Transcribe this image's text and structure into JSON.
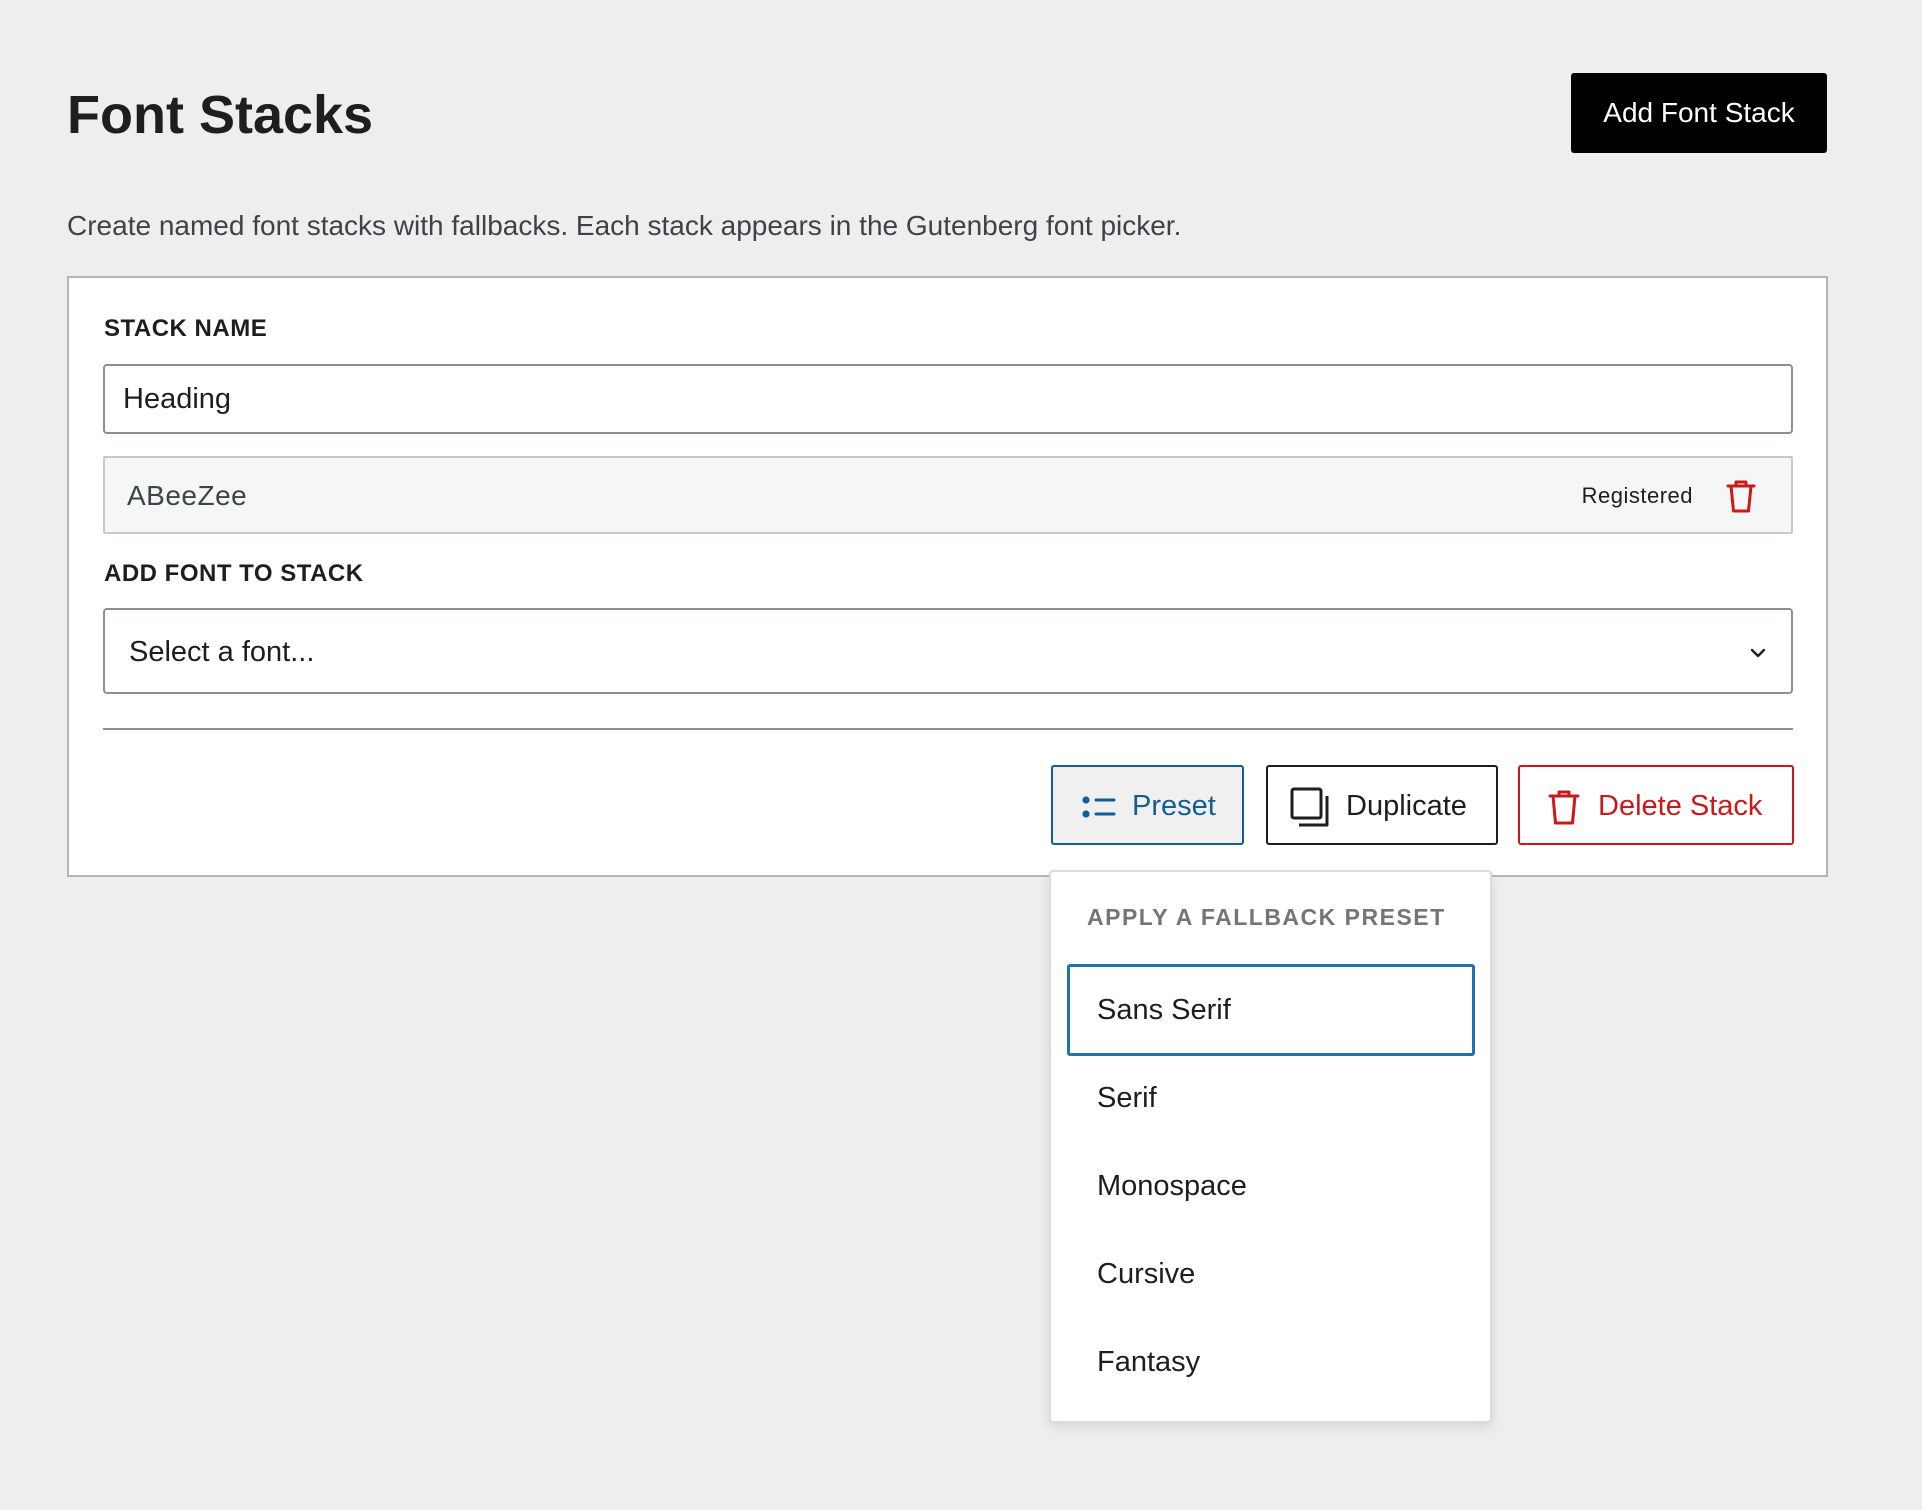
{
  "header": {
    "title": "Font Stacks",
    "add_button_label": "Add Font Stack"
  },
  "description": "Create named font stacks with fallbacks. Each stack appears in the Gutenberg font picker.",
  "stack": {
    "name_label": "STACK NAME",
    "name_value": "Heading",
    "fonts": [
      {
        "name": "ABeeZee",
        "badge": "Registered"
      }
    ],
    "add_font_label": "ADD FONT TO STACK",
    "select_placeholder": "Select a font..."
  },
  "actions": {
    "preset_label": "Preset",
    "duplicate_label": "Duplicate",
    "delete_label": "Delete Stack"
  },
  "preset_menu": {
    "heading": "APPLY A FALLBACK PRESET",
    "items": [
      {
        "label": "Sans Serif",
        "focused": true
      },
      {
        "label": "Serif"
      },
      {
        "label": "Monospace"
      },
      {
        "label": "Cursive"
      },
      {
        "label": "Fantasy"
      }
    ]
  },
  "icons": {
    "chevron": "chevron-down-icon",
    "trash": "trash-icon",
    "list": "list-icon",
    "duplicate": "duplicate-icon"
  },
  "colors": {
    "primary_button": "#000000",
    "accent_blue": "#135e96",
    "focus_blue": "#2271b1",
    "destructive": "#cc1818",
    "page_background": "#eeeeee"
  }
}
